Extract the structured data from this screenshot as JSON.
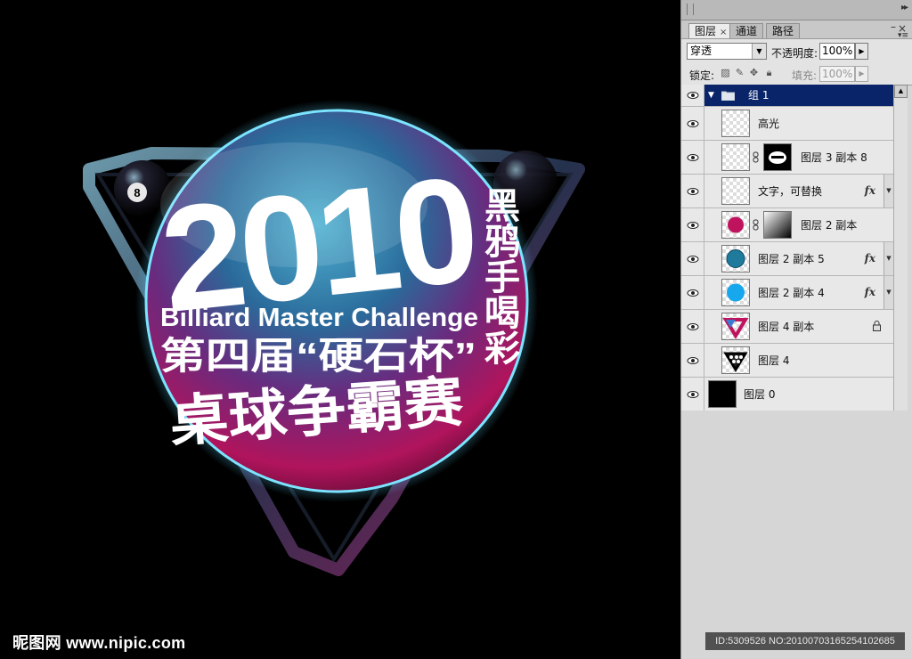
{
  "canvas": {
    "artwork": {
      "year": "2010",
      "subtitle_en": "Billiard Master Challenge",
      "line_cn_1": "第四届“硬石杯”",
      "line_cn_2": "桌球争霸赛",
      "side_text": "黑鸦手喝彩",
      "ball_8_numeral": "8"
    },
    "watermark": "昵图网 www.nipic.com"
  },
  "layers_panel": {
    "tabs": [
      {
        "label": "图层",
        "active": true,
        "close": "×"
      },
      {
        "label": "通道",
        "active": false
      },
      {
        "label": "路径",
        "active": false
      }
    ],
    "blend_mode": "穿透",
    "opacity_label": "不透明度:",
    "opacity_value": "100%",
    "lock_label": "锁定:",
    "fill_label": "填充:",
    "fill_value": "100%",
    "layers": [
      {
        "name": "组 1",
        "type": "group",
        "selected": true
      },
      {
        "name": "高光",
        "type": "layer"
      },
      {
        "name": "图层 3 副本 8",
        "type": "layer",
        "mask": true
      },
      {
        "name": "文字，可替换",
        "type": "layer",
        "fx": "fx"
      },
      {
        "name": "图层 2 副本",
        "type": "layer",
        "mask": true
      },
      {
        "name": "图层 2 副本 5",
        "type": "layer",
        "fx": "fx"
      },
      {
        "name": "图层 2 副本 4",
        "type": "layer",
        "fx": "fx"
      },
      {
        "name": "图层 4 副本",
        "type": "layer",
        "locked": true
      },
      {
        "name": "图层 4",
        "type": "layer"
      },
      {
        "name": "图层 0",
        "type": "layer"
      }
    ]
  },
  "id_bar": "ID:5309526 NO:20100703165254102685",
  "icons": {
    "eye": "eye-icon",
    "folder": "folder-icon",
    "chain": "link-icon",
    "lock": "lock-icon",
    "fx": "fx-icon"
  },
  "colors": {
    "selection": "#0a246a",
    "panel_bg": "#d6d6d6",
    "ball_teal": "#1f7a9c",
    "ball_magenta": "#c0135e",
    "glow": "#4cd3ff"
  }
}
